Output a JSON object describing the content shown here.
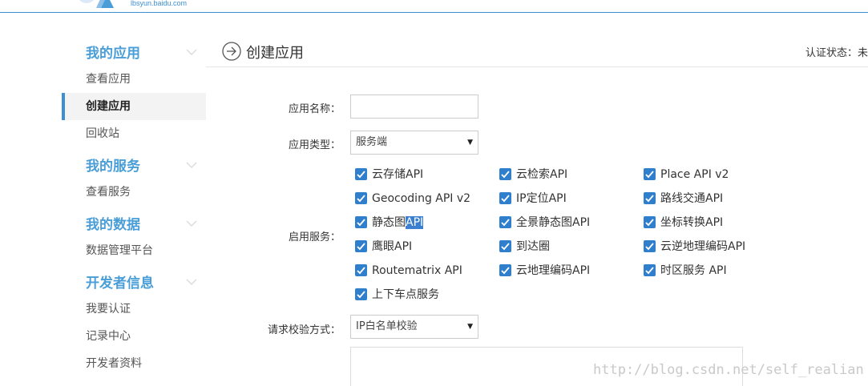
{
  "header": {
    "logo_text": "lbsyun.baidu.com"
  },
  "sidebar": {
    "groups": [
      {
        "title": "我的应用"
      },
      {
        "title": "我的服务"
      },
      {
        "title": "我的数据"
      },
      {
        "title": "开发者信息"
      }
    ],
    "items": [
      {
        "label": "查看应用"
      },
      {
        "label": "创建应用"
      },
      {
        "label": "回收站"
      },
      {
        "label": "查看服务"
      },
      {
        "label": "数据管理平台"
      },
      {
        "label": "我要认证"
      },
      {
        "label": "记录中心"
      },
      {
        "label": "开发者资料"
      }
    ],
    "active_item": "创建应用"
  },
  "main": {
    "title": "创建应用",
    "auth_status": "认证状态：未"
  },
  "form": {
    "app_name_label": "应用名称：",
    "app_name_value": "",
    "app_type_label": "应用类型：",
    "app_type_value": "服务端",
    "services_label": "启用服务：",
    "services": [
      {
        "label": "云存储API",
        "checked": true
      },
      {
        "label": "云检索API",
        "checked": true
      },
      {
        "label": "Place API v2",
        "checked": true
      },
      {
        "label": "Geocoding API v2",
        "checked": true
      },
      {
        "label": "IP定位API",
        "checked": true
      },
      {
        "label": "路线交通API",
        "checked": true
      },
      {
        "label_pre": "静态图",
        "label_hl": "API",
        "checked": true
      },
      {
        "label": "全景静态图API",
        "checked": true
      },
      {
        "label": "坐标转换API",
        "checked": true
      },
      {
        "label": "鹰眼API",
        "checked": true
      },
      {
        "label": "到达圈",
        "checked": true
      },
      {
        "label": "云逆地理编码API",
        "checked": true
      },
      {
        "label": "Routematrix API",
        "checked": true
      },
      {
        "label": "云地理编码API",
        "checked": true
      },
      {
        "label": "时区服务 API",
        "checked": true
      },
      {
        "label": "上下车点服务",
        "checked": true
      }
    ],
    "verify_label": "请求校验方式：",
    "verify_value": "IP白名单校验"
  },
  "watermark": "http://blog.csdn.net/self_realian",
  "colors": {
    "accent": "#3d8fd1",
    "checkbox": "#2f7fcc",
    "group_title": "#4a9ed8"
  }
}
